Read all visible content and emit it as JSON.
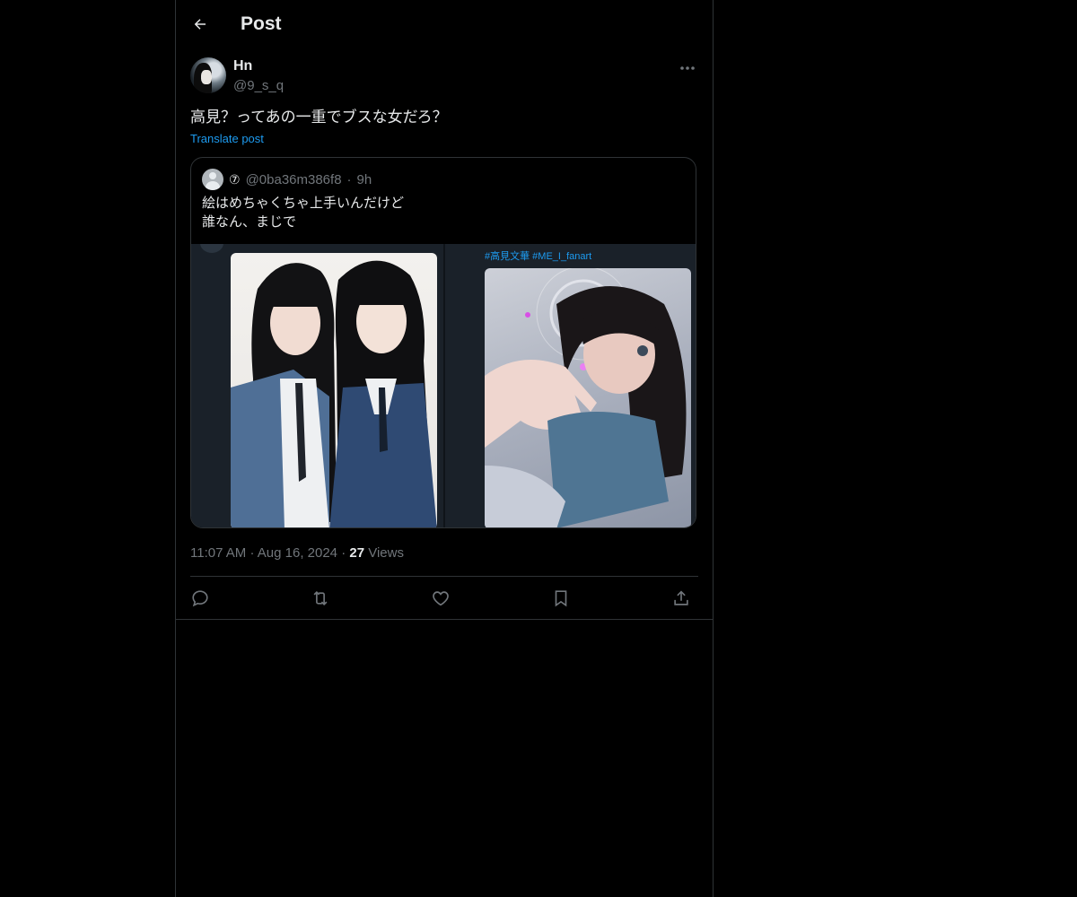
{
  "header": {
    "title": "Post"
  },
  "author": {
    "display_name": "Hn",
    "handle": "@9_s_q"
  },
  "post": {
    "text": "高見？ってあの一重でブスな女だろ？",
    "translate_label": "Translate post",
    "time": "11:07 AM",
    "date": "Aug 16, 2024",
    "views_count": "27",
    "views_label": "Views"
  },
  "quote": {
    "badge": "⑦",
    "handle": "@0ba36m386f8",
    "separator": "·",
    "age": "9h",
    "text_lines": [
      "絵はめちゃくちゃ上手いんだけど",
      "誰なん、まじで"
    ],
    "media_hashtags": "#高見文華 #ME_I_fanart"
  },
  "actions": {
    "reply": "reply-icon",
    "repost": "repost-icon",
    "like": "like-icon",
    "bookmark": "bookmark-icon",
    "share": "share-icon"
  },
  "colors": {
    "background": "#000000",
    "text": "#e7e9ea",
    "muted": "#71767b",
    "accent": "#1d9bf0",
    "border": "#2f3336"
  }
}
